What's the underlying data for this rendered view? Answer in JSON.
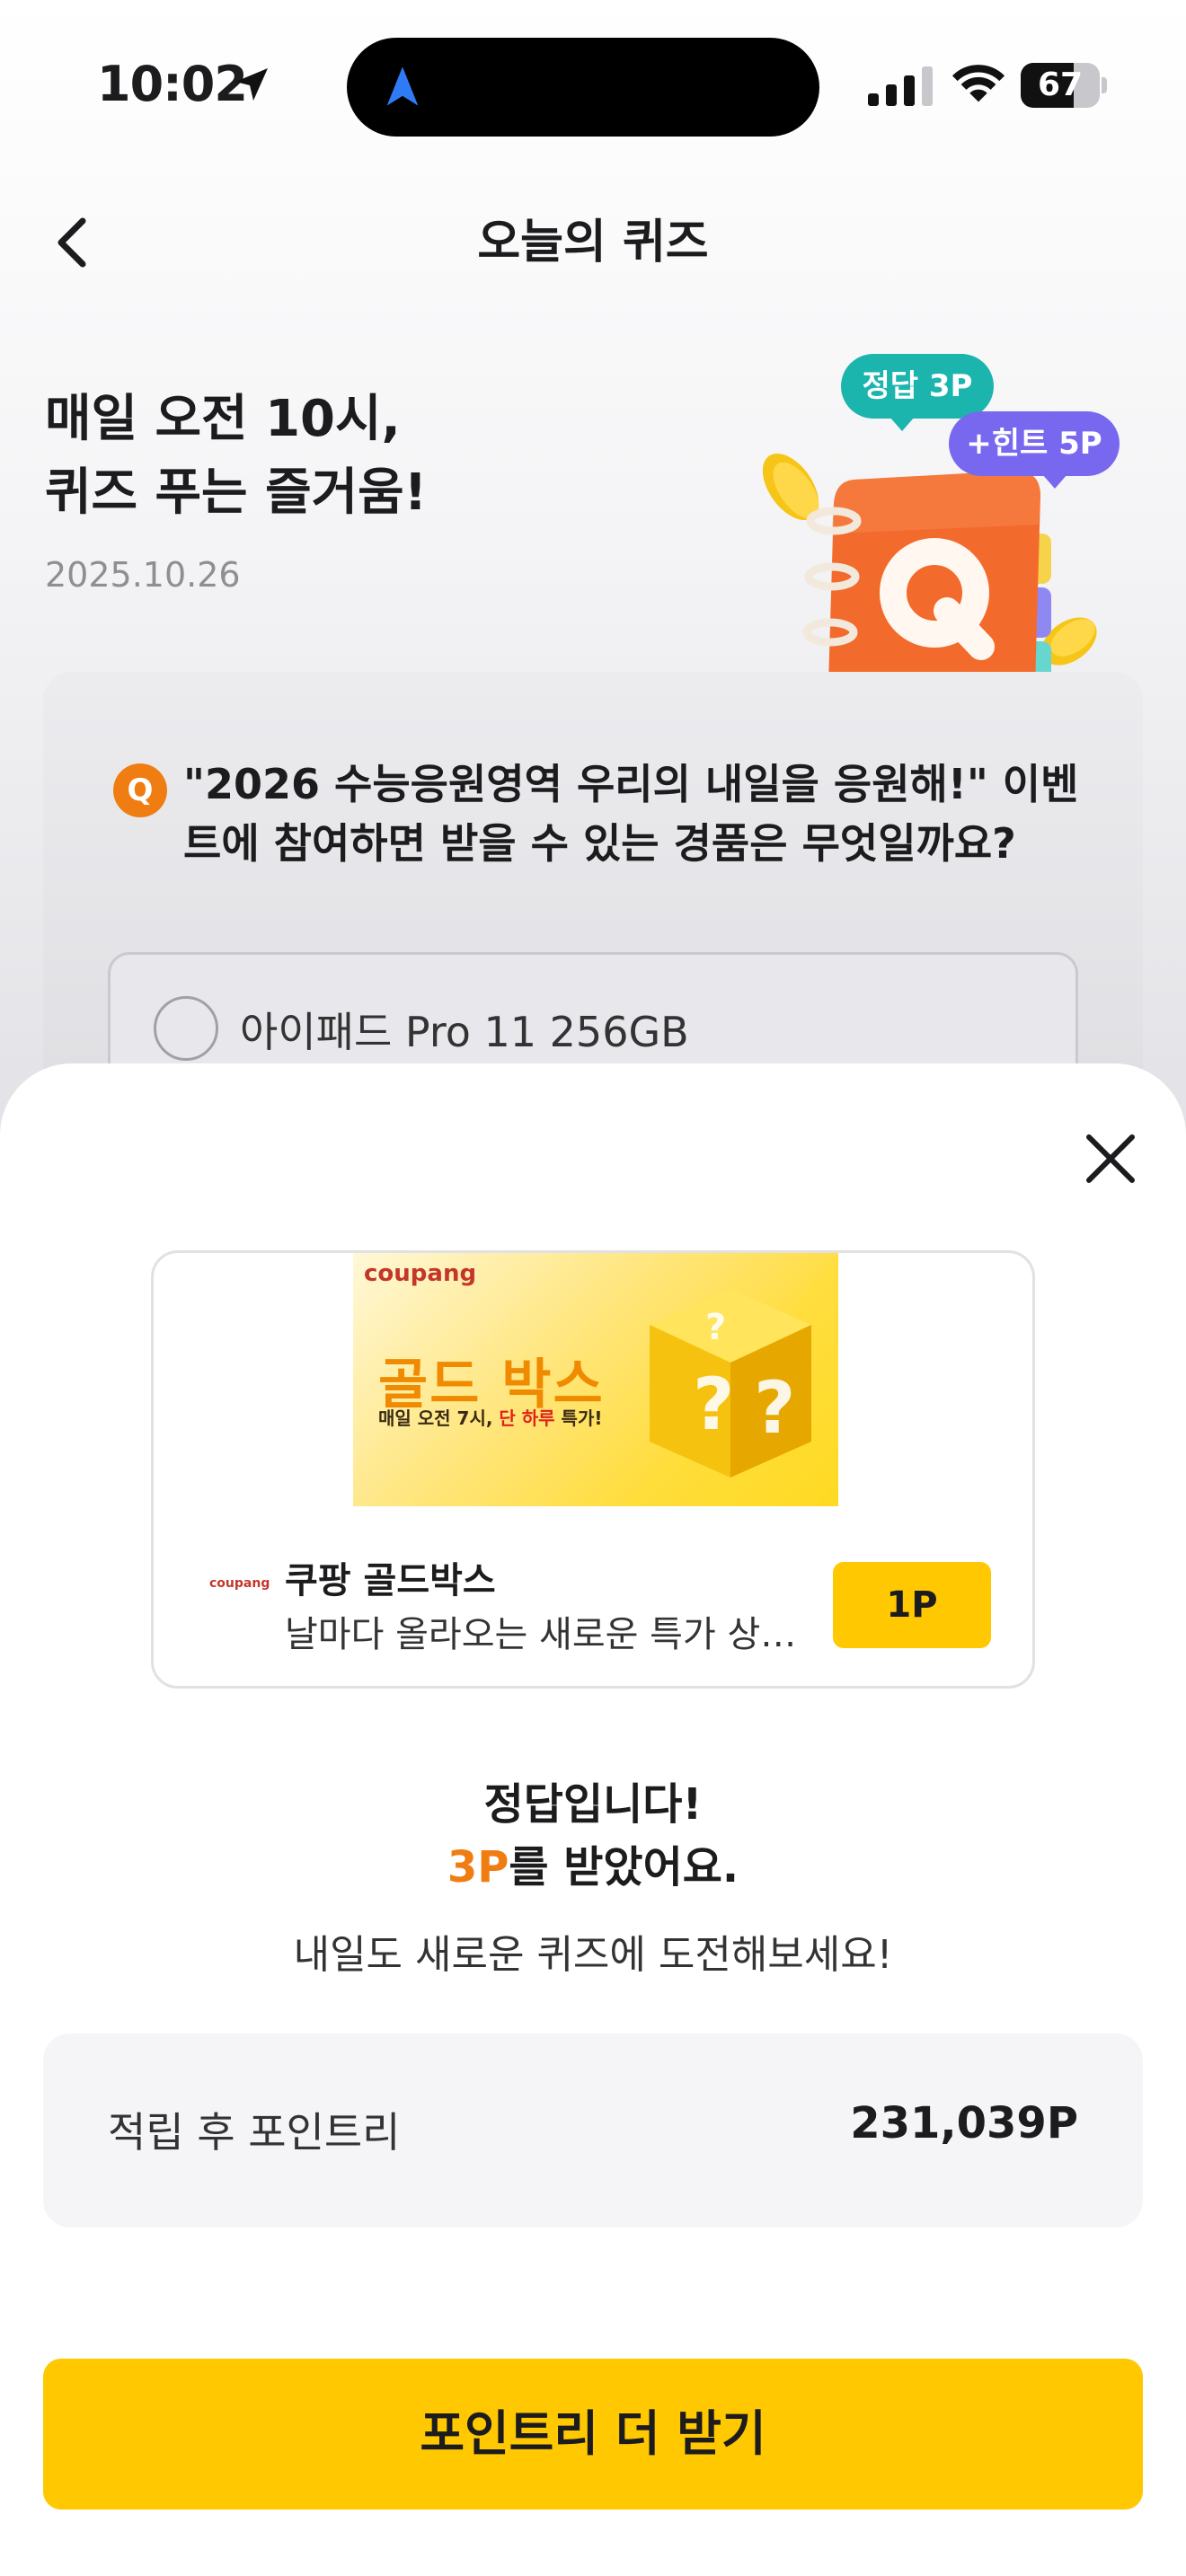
{
  "status_bar": {
    "time": "10:02",
    "battery": "67",
    "battery_level": 0.67
  },
  "header": {
    "title": "오늘의 퀴즈"
  },
  "hero": {
    "title_line1": "매일 오전 10시,",
    "title_line2": "퀴즈 푸는 즐거움!",
    "date": "2025.10.26",
    "badge_correct": "정답 3P",
    "badge_hint": "+힌트 5P",
    "icon_letter": "Q"
  },
  "quiz": {
    "badge": "Q",
    "question": "\"2026 수능응원영역 우리의 내일을 응원해!\" 이벤트에 참여하면 받을 수 있는 경품은 무엇일까요?",
    "options": [
      {
        "label": "아이패드 Pro 11 256GB"
      }
    ]
  },
  "ad": {
    "banner_brand": "coupang",
    "banner_headline": "골드 박스",
    "banner_sub_a": "매일 오전 7시, ",
    "banner_sub_red": "단 하루",
    "banner_sub_b": " 특가!",
    "logo_text": "coupang",
    "title": "쿠팡 골드박스",
    "description": "날마다 올라오는 새로운 특가 상품을 만나보세요",
    "points_button": "1P"
  },
  "result": {
    "title": "정답입니다!",
    "points_amount": "3P",
    "points_suffix": "를 받았어요.",
    "hint": "내일도 새로운 퀴즈에 도전해보세요!"
  },
  "balance": {
    "label": "적립 후 포인트리",
    "value": "231,039P"
  },
  "cta": {
    "label": "포인트리 더 받기"
  },
  "colors": {
    "accent_yellow": "#ffc800",
    "accent_orange": "#f07d12",
    "teal": "#1bb5ad",
    "purple": "#7868f0",
    "location_blue": "#2f7bf6"
  }
}
